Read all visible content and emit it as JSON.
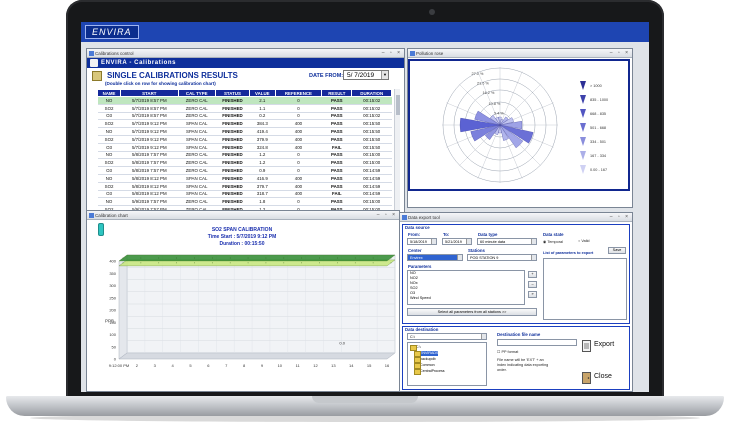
{
  "app": {
    "logo": "ENVIRA"
  },
  "calibrations": {
    "window_title": "Calibrations control",
    "header": "ENVIRA - Calibrations",
    "title": "SINGLE CALIBRATIONS RESULTS",
    "subtitle": "(Double click on row for showing calibration chart)",
    "date_from_label": "DATE FROM:",
    "date_from_value": "5/ 7/2019",
    "columns": [
      "NAME",
      "START",
      "CAL TYPE",
      "STATUS",
      "VALUE",
      "REFERENCE",
      "RESULT",
      "DURATION"
    ],
    "rows": [
      [
        "NO",
        "5/7/2019 8:57 PM",
        "ZERO CAL",
        "FINISHED",
        "2.1",
        "0",
        "PASS",
        "00:15:02"
      ],
      [
        "SO2",
        "5/7/2019 8:57 PM",
        "ZERO CAL",
        "FINISHED",
        "1.1",
        "0",
        "PASS",
        "00:15:02"
      ],
      [
        "O3",
        "5/7/2019 8:57 PM",
        "ZERO CAL",
        "FINISHED",
        "0.2",
        "0",
        "PASS",
        "00:15:02"
      ],
      [
        "SO2",
        "5/7/2019 9:12 PM",
        "SPAN CAL",
        "FINISHED",
        "384.3",
        "400",
        "PASS",
        "00:15:50"
      ],
      [
        "NO",
        "5/7/2019 9:12 PM",
        "SPAN CAL",
        "FINISHED",
        "419.4",
        "400",
        "PASS",
        "00:15:50"
      ],
      [
        "SO2",
        "5/7/2019 9:12 PM",
        "SPAN CAL",
        "FINISHED",
        "379.9",
        "400",
        "PASS",
        "00:15:50"
      ],
      [
        "O3",
        "5/7/2019 9:12 PM",
        "SPAN CAL",
        "FINISHED",
        "324.8",
        "400",
        "FAIL",
        "00:15:50"
      ],
      [
        "NO",
        "5/8/2019 7:57 PM",
        "ZERO CAL",
        "FINISHED",
        "1.2",
        "0",
        "PASS",
        "00:15:00"
      ],
      [
        "SO2",
        "5/8/2019 7:57 PM",
        "ZERO CAL",
        "FINISHED",
        "1.2",
        "0",
        "PASS",
        "00:15:00"
      ],
      [
        "O3",
        "5/8/2019 7:57 PM",
        "ZERO CAL",
        "FINISHED",
        "0.9",
        "0",
        "PASS",
        "00:14:59"
      ],
      [
        "NO",
        "5/8/2019 8:12 PM",
        "SPAN CAL",
        "FINISHED",
        "416.9",
        "400",
        "PASS",
        "00:14:59"
      ],
      [
        "SO2",
        "5/8/2019 8:12 PM",
        "SPAN CAL",
        "FINISHED",
        "379.7",
        "400",
        "PASS",
        "00:14:59"
      ],
      [
        "O3",
        "5/8/2019 8:12 PM",
        "SPAN CAL",
        "FINISHED",
        "318.7",
        "400",
        "FAIL",
        "00:14:59"
      ],
      [
        "NO",
        "5/9/2019 7:57 PM",
        "ZERO CAL",
        "FINISHED",
        "1.8",
        "0",
        "PASS",
        "00:15:00"
      ],
      [
        "SO2",
        "5/9/2019 7:57 PM",
        "ZERO CAL",
        "FINISHED",
        "1.2",
        "0",
        "PASS",
        "00:15:00"
      ]
    ],
    "colors": {
      "header_bg": "#0e2f9b",
      "pass": "#168a16",
      "fail": "#d01010",
      "selected_row": "#bfe6bf"
    }
  },
  "pollution": {
    "window_title": "Pollution rose",
    "ring_labels": [
      "27.0 %",
      "21.6 %",
      "16.2 %",
      "10.8 %",
      "5.4 %"
    ],
    "legend": [
      "> 1000",
      "835 - 1000",
      "668 - 835",
      "501 - 668",
      "334 - 501",
      "167 - 334",
      "0.00 - 167"
    ]
  },
  "chart": {
    "window_title": "Calibration chart",
    "title": "SO2 SPAN CALIBRATION",
    "time_start": "Time Start : 5/7/2019 9:12 PM",
    "duration": "Duration : 00:15:50",
    "y_label": "PPB",
    "annotation": "0.0",
    "chart_data": {
      "type": "line",
      "title": "SO2 SPAN CALIBRATION",
      "xlabel": "",
      "ylabel": "PPB",
      "x_ticks": [
        "9:12:00 PM",
        "2",
        "3",
        "4",
        "5",
        "6",
        "7",
        "8",
        "9",
        "10",
        "11",
        "12",
        "13",
        "14",
        "15",
        "16"
      ],
      "y_ticks": [
        0,
        50,
        100,
        150,
        200,
        250,
        300,
        350,
        400
      ],
      "ylim": [
        0,
        400
      ],
      "series": [
        {
          "name": "",
          "values": [
            400,
            400,
            400,
            400,
            400,
            400,
            400,
            400,
            400,
            400,
            400,
            400,
            400,
            400,
            400,
            400
          ],
          "color": "#2f8a2f"
        },
        {
          "name": "",
          "values": [
            380,
            380,
            380,
            380,
            380,
            380,
            380,
            380,
            380,
            380,
            380,
            380,
            380,
            380,
            380,
            380
          ],
          "color": "#c7e67a"
        }
      ]
    }
  },
  "export": {
    "window_title": "Data export tool",
    "data_source_label": "Data source",
    "from_label": "From:",
    "from_value": "5/18/2019",
    "to_label": "To:",
    "to_value": "5/21/2019",
    "data_type_label": "Data type",
    "data_type_value": "60 minute data",
    "data_state_label": "Data state",
    "state_temporal": "Temporal",
    "state_valid": "Valid",
    "save_label": "Save",
    "center_label": "Center",
    "center_value": "Envirex",
    "stations_label": "Stations",
    "stations_value": "POD STATION 9",
    "parameters_label": "Parameters",
    "parameters": [
      "NO",
      "NO2",
      "NOx",
      "SO2",
      "O3",
      "Wind Speed"
    ],
    "export_list_label": "List of parameters to export",
    "select_all_label": "Select all parameters from all stations >>",
    "destination_label": "Data destination",
    "drive_value": "C:\\",
    "folders": [
      "C:\\",
      "ENVIRADS",
      "backupdb",
      "Common",
      "CentralProcess"
    ],
    "file_name_label": "Destination file name",
    "export_label": "Export",
    "format_label": "PP format",
    "note": "File name will be 'EXT' + an index indicating data exporting order.",
    "close_label": "Close"
  }
}
